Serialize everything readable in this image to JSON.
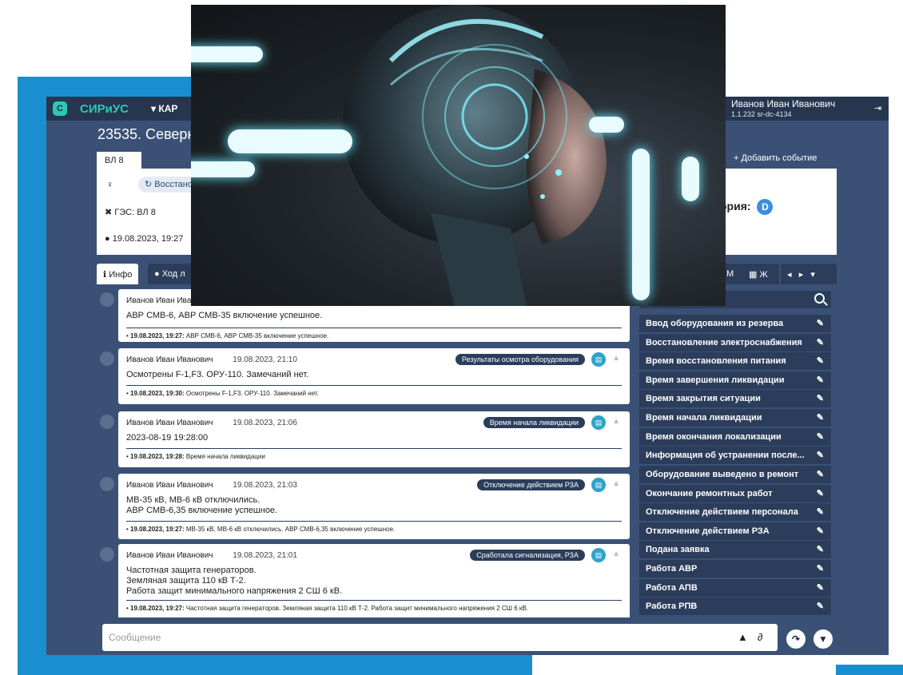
{
  "app": {
    "brand": "СИРиУС",
    "logo_letter": "C",
    "menu_label": "▾ КАР",
    "user_name": "Иванов Иван Иванович",
    "user_meta": "1.1.232  sr-dc-4134"
  },
  "page": {
    "title": "23535. Северн",
    "tab": "ВЛ 8",
    "add_event": "+ Добавить событие",
    "restore_pill": "Восстано",
    "object": "ГЭС: ВЛ 8",
    "datetime": "19.08.2023, 19:27",
    "category_label": "ория:",
    "category_value": "D"
  },
  "tabs": {
    "info": "Инфо",
    "course": "Ход л",
    "m": "М",
    "j": "Ж"
  },
  "messages": [
    {
      "author": "Иванов Иван Ива",
      "time": "",
      "badge": "",
      "body": "АВР СМВ-6, АВР СМВ-35 включение успешное.",
      "foot_date": "19.08.2023, 19:27:",
      "foot_text": " АВР СМВ-6, АВР СМВ-35 включение успешное."
    },
    {
      "author": "Иванов Иван Иванович",
      "time": "19.08.2023, 21:10",
      "badge": "Результаты осмотра оборудования",
      "body": "Осмотрены F-1,F3. ОРУ-110. Замечаний нет.",
      "foot_date": "19.08.2023, 19:30:",
      "foot_text": " Осмотрены F-1,F3. ОРУ-110. Замечаний нет."
    },
    {
      "author": "Иванов Иван Иванович",
      "time": "19.08.2023, 21:06",
      "badge": "Время начала ликвидации",
      "body": "2023-08-19 19:28:00",
      "foot_date": "19.08.2023, 19:28:",
      "foot_text": " Время начала ликвидации"
    },
    {
      "author": "Иванов Иван Иванович",
      "time": "19.08.2023, 21:03",
      "badge": "Отключение действием РЗА",
      "body": "МВ-35 кВ, МВ-6 кВ отключились.\nАВР СМВ-6,35 включение успешное.",
      "foot_date": "19.08.2023, 19:27:",
      "foot_text": " МВ-35 кВ, МВ-6 кВ отключились. АВР СМВ-6,35 включение успешное."
    },
    {
      "author": "Иванов Иван Иванович",
      "time": "19.08.2023, 21:01",
      "badge": "Сработала сигнализация, РЗА",
      "body": "Частотная защита генераторов.\nЗемляная защита 110 кВ Т-2.\nРабота защит минимального напряжения 2 СШ 6 кВ.",
      "foot_date": "19.08.2023, 19:27:",
      "foot_text": " Частотная защита генераторов. Земляная защита 110 кВ Т-2. Работа защит минимального напряжения 2 СШ 6 кВ."
    }
  ],
  "side_items": [
    "Ввод оборудования из резерва",
    "Восстановление электроснабжения",
    "Время восстановления питания",
    "Время завершения ликвидации",
    "Время закрытия ситуации",
    "Время начала ликвидации",
    "Время окончания локализации",
    "Информация об устранении после...",
    "Оборудование выведено в ремонт",
    "Окончание ремонтных работ",
    "Отключение действием персонала",
    "Отключение действием РЗА",
    "Подана заявка",
    "Работа АВР",
    "Работа АПВ",
    "Работа РПВ"
  ],
  "composer": {
    "placeholder": "Сообщение"
  },
  "icons": {
    "search": "search-icon",
    "edit": "pencil-icon",
    "bell": "bell-icon",
    "attach": "paperclip-icon",
    "send": "share-icon",
    "filter": "filter-icon"
  },
  "colors": {
    "background_blue": "#1a8fd0",
    "app_body": "#3a5175",
    "topbar": "#26364f",
    "accent": "#2ec7b8"
  }
}
